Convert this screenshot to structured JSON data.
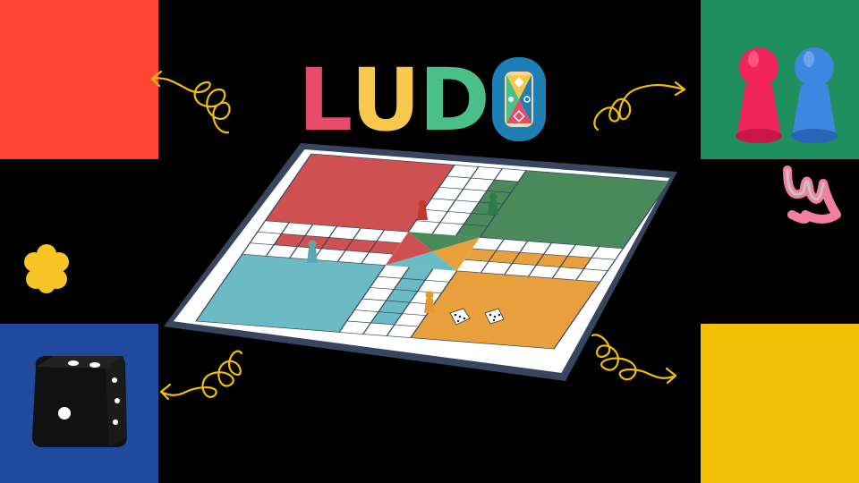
{
  "title": {
    "letters": [
      "L",
      "U",
      "D"
    ],
    "colors": [
      "#e84a6a",
      "#f7c84c",
      "#4bbf8a"
    ],
    "o_icon_colors": [
      "#1f7fb4",
      "#f7c84c",
      "#e84a6a",
      "#4bbf8a"
    ]
  },
  "corner_blocks": {
    "top_left": "#ff4433",
    "top_right": "#1f8f5f",
    "bottom_left": "#1f4a9e",
    "bottom_right": "#f2bf05"
  },
  "board": {
    "home_colors": {
      "red": "#cf5050",
      "green": "#4a8a5a",
      "blue": "#6bbac4",
      "orange": "#e7a03c"
    },
    "frame_color": "#37465e",
    "dice_on_board": 2,
    "pawns_on_board": [
      "red",
      "green",
      "blue",
      "orange"
    ]
  },
  "decorations": {
    "die_icon": "black-die-icon",
    "pawn_icons": [
      "red-pawn-icon",
      "blue-pawn-icon"
    ],
    "flower_icon": "yellow-flower-icon",
    "squiggle_color": "#f2bf05",
    "pink_squiggle_color": "#f27fa0"
  }
}
